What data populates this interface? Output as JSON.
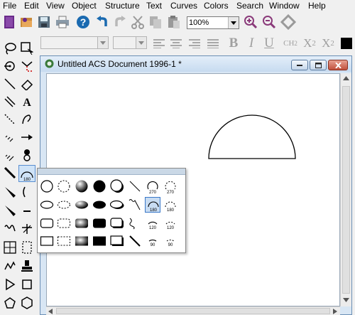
{
  "menubar": {
    "items": [
      "File",
      "Edit",
      "View",
      "Object",
      "Structure",
      "Text",
      "Curves",
      "Colors",
      "Search",
      "Window",
      "Help"
    ]
  },
  "toolbar": {
    "zoom_value": "100%",
    "format": {
      "bold": "B",
      "italic": "I",
      "underline": "U",
      "ch2": "CH",
      "ch2_sub": "2",
      "subscript": "X",
      "subscript_mark": "2",
      "superscript": "X",
      "superscript_mark": "2"
    }
  },
  "document": {
    "title": "Untitled ACS Document 1996-1 *"
  },
  "popup": {
    "arc_labels": {
      "a270": "270",
      "b270": "270",
      "a180": "180",
      "b180": "180",
      "a120": "120",
      "b120": "120",
      "a90": "90",
      "b90": "90"
    }
  },
  "palette": {
    "selected_tool_label": "180"
  },
  "icons": [
    "new-document-icon",
    "open-icon",
    "save-icon",
    "print-icon",
    "help-icon",
    "undo-icon",
    "redo-icon",
    "cut-icon",
    "copy-icon",
    "paste-icon",
    "zoom-in-icon",
    "zoom-out-icon",
    "fit-icon",
    "lasso-icon",
    "marquee-icon",
    "rotate-icon",
    "bond-icon",
    "eraser-icon",
    "text-icon"
  ],
  "colors": {
    "accent": "#3a78c8",
    "selected_bg": "#c8dcf2",
    "window_frame": "#d8e6f4"
  }
}
